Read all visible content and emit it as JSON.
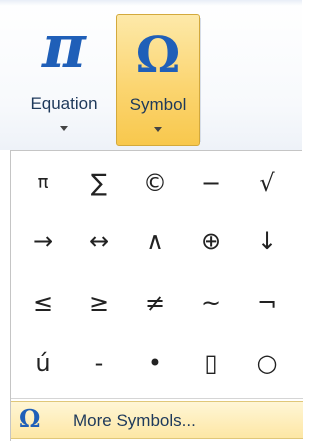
{
  "ribbon": {
    "equation": {
      "glyph": "π",
      "label": "Equation"
    },
    "symbol": {
      "glyph": "Ω",
      "label": "Symbol"
    }
  },
  "gallery": {
    "rows": [
      [
        "π",
        "∑",
        "©",
        "−",
        "√"
      ],
      [
        "→",
        "↔",
        "∧",
        "⊕",
        "↓"
      ],
      [
        "≤",
        "≥",
        "≠",
        "~",
        "¬"
      ],
      [
        "ú",
        "-",
        "•",
        "▯",
        "○"
      ]
    ]
  },
  "more_symbols": {
    "glyph": "Ω",
    "label": "More Symbols..."
  },
  "colors": {
    "accent": "#1f5fb8",
    "hover": "#fbd571"
  }
}
